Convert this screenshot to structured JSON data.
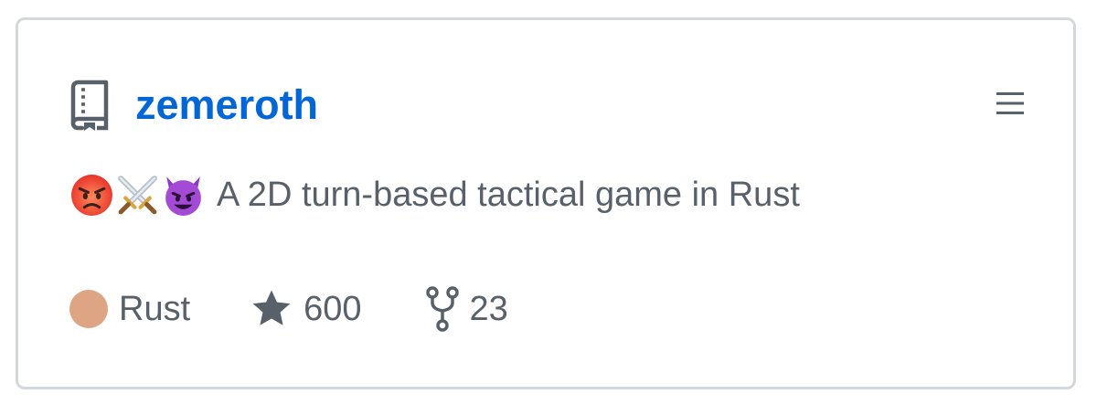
{
  "repo": {
    "name": "zemeroth",
    "description": "A 2D turn-based tactical game in Rust",
    "description_emoji": [
      "angry-face-icon",
      "crossed-swords-icon",
      "smiling-imp-icon"
    ],
    "language": "Rust",
    "language_color": "#dea584",
    "stars": "600",
    "forks": "23"
  },
  "colors": {
    "link": "#0366d6",
    "muted": "#586069",
    "border": "#d4d8dd"
  },
  "icons": {
    "repo": "repo-book-icon",
    "menu": "hamburger-menu-icon",
    "star": "star-icon",
    "fork": "fork-icon"
  }
}
